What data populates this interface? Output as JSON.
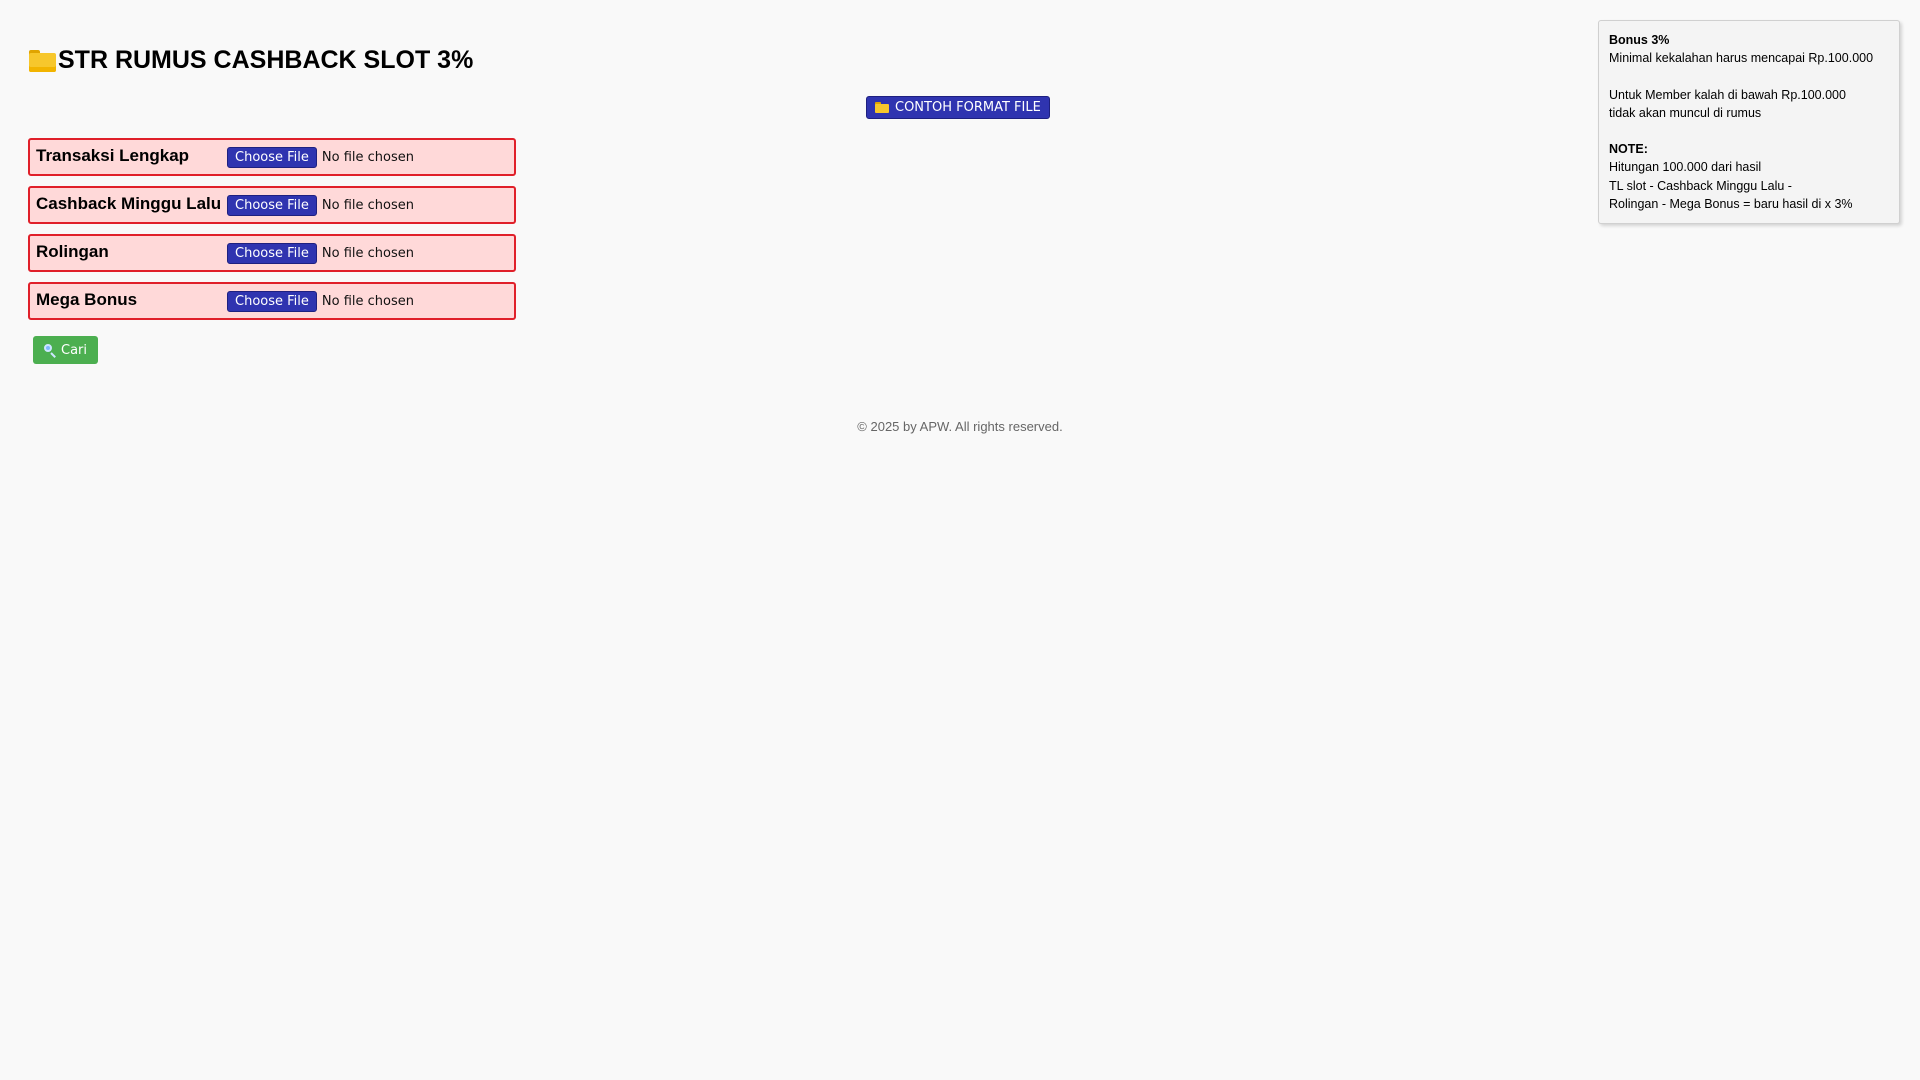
{
  "header": {
    "title": "STR RUMUS CASHBACK SLOT 3%",
    "title_icon": "folder-icon"
  },
  "sample_button": {
    "label": "CONTOH FORMAT FILE",
    "icon": "folder-icon"
  },
  "uploads": [
    {
      "label": "Transaksi Lengkap",
      "button": "Choose File",
      "status": "No file chosen"
    },
    {
      "label": "Cashback Minggu Lalu",
      "button": "Choose File",
      "status": "No file chosen"
    },
    {
      "label": "Rolingan",
      "button": "Choose File",
      "status": "No file chosen"
    },
    {
      "label": "Mega Bonus",
      "button": "Choose File",
      "status": "No file chosen"
    }
  ],
  "search_button": {
    "label": "Cari",
    "icon": "magnifier-icon"
  },
  "footer": {
    "text": "© 2025 by APW. All rights reserved."
  },
  "info_panel": {
    "heading": "Bonus 3%",
    "line1": "Minimal kekalahan harus mencapai Rp.100.000",
    "line2": "Untuk Member kalah di bawah Rp.100.000",
    "line3": "tidak akan muncul di rumus",
    "note_heading": "NOTE:",
    "note1": "Hitungan 100.000 dari hasil",
    "note2": "TL slot - Cashback Minggu Lalu -",
    "note3": "Rolingan - Mega Bonus = baru hasil di x 3%"
  },
  "colors": {
    "accent_blue": "#2f34b0",
    "row_border": "#e0202a",
    "row_background": "#ffd9d9",
    "search_green": "#4caf50"
  }
}
